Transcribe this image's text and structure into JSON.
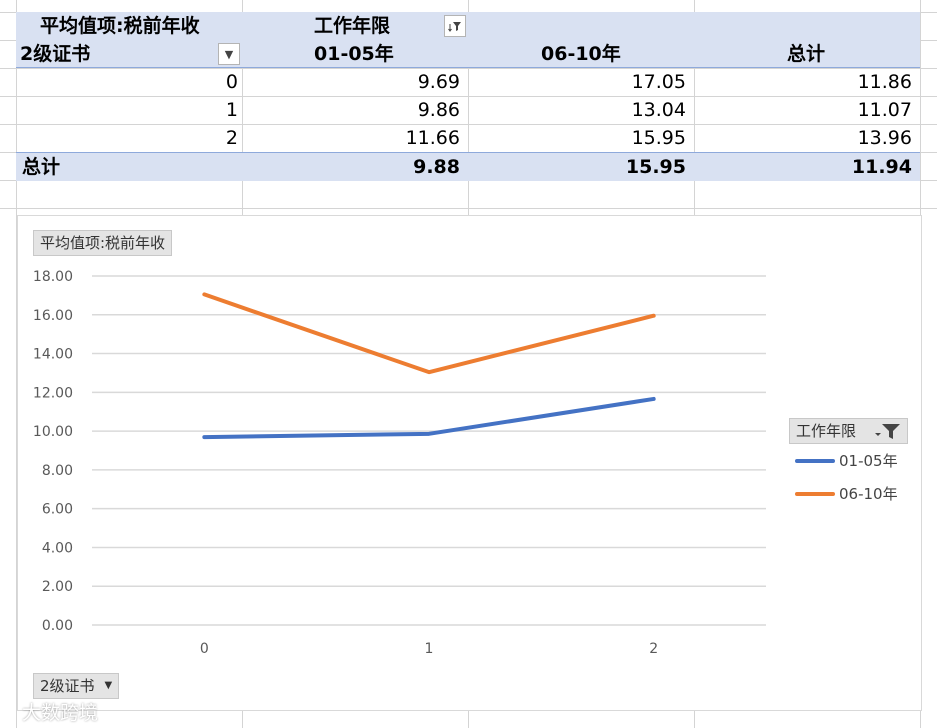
{
  "pivot": {
    "value_field": "平均值项:税前年收",
    "column_field": "工作年限",
    "row_field": "2级证书",
    "columns": [
      "01-05年",
      "06-10年",
      "总计"
    ],
    "rows": [
      {
        "label": "0",
        "values": [
          "9.69",
          "17.05",
          "11.86"
        ]
      },
      {
        "label": "1",
        "values": [
          "9.86",
          "13.04",
          "11.07"
        ]
      },
      {
        "label": "2",
        "values": [
          "11.66",
          "15.95",
          "13.96"
        ]
      }
    ],
    "total": {
      "label": "总计",
      "values": [
        "9.88",
        "15.95",
        "11.94"
      ]
    }
  },
  "chart_buttons": {
    "value_field": "平均值项:税前年收",
    "legend_field": "工作年限",
    "axis_field": "2级证书"
  },
  "chart_data": {
    "type": "line",
    "categories": [
      "0",
      "1",
      "2"
    ],
    "series": [
      {
        "name": "01-05年",
        "values": [
          9.69,
          9.86,
          11.66
        ],
        "color": "#4472c4"
      },
      {
        "name": "06-10年",
        "values": [
          17.05,
          13.04,
          15.95
        ],
        "color": "#ed7d31"
      }
    ],
    "ylim": [
      0,
      18
    ],
    "yticks": [
      "0.00",
      "2.00",
      "4.00",
      "6.00",
      "8.00",
      "10.00",
      "12.00",
      "14.00",
      "16.00",
      "18.00"
    ],
    "grid": true,
    "legend": "right"
  },
  "watermark": "大数跨境"
}
